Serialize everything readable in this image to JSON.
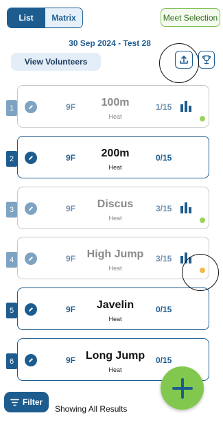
{
  "toggle": {
    "list_label": "List",
    "matrix_label": "Matrix",
    "active": "List"
  },
  "meet_selection_label": "Meet Selection",
  "meet_title": "30 Sep 2024 - Test 28",
  "view_volunteers_label": "View Volunteers",
  "icons": {
    "upload": "upload-icon",
    "trophy": "trophy-icon",
    "edit": "edit-icon",
    "bar_chart": "bar-chart-icon",
    "filter": "filter-icon",
    "add": "plus-icon"
  },
  "colors": {
    "primary": "#1d5c8f",
    "green": "#82c84f",
    "status_green": "#9bd35a",
    "status_orange": "#f2b84b",
    "dim_border": "#c8c8c8"
  },
  "events": [
    {
      "index": "1",
      "grade": "9F",
      "name": "100m",
      "subtitle": "Heat",
      "count": "1/15",
      "has_chart": true,
      "status": "green",
      "dimmed": true
    },
    {
      "index": "2",
      "grade": "9F",
      "name": "200m",
      "subtitle": "Heat",
      "count": "0/15",
      "has_chart": false,
      "status": null,
      "dimmed": false
    },
    {
      "index": "3",
      "grade": "9F",
      "name": "Discus",
      "subtitle": "Heat",
      "count": "3/15",
      "has_chart": true,
      "status": "green",
      "dimmed": true
    },
    {
      "index": "4",
      "grade": "9F",
      "name": "High Jump",
      "subtitle": "Heat",
      "count": "3/15",
      "has_chart": true,
      "status": "orange",
      "dimmed": true
    },
    {
      "index": "5",
      "grade": "9F",
      "name": "Javelin",
      "subtitle": "Heat",
      "count": "0/15",
      "has_chart": false,
      "status": null,
      "dimmed": false
    },
    {
      "index": "6",
      "grade": "9F",
      "name": "Long Jump",
      "subtitle": "Heat",
      "count": "0/15",
      "has_chart": false,
      "status": null,
      "dimmed": false
    }
  ],
  "filter_label": "Filter",
  "results_status": "Showing All Results"
}
